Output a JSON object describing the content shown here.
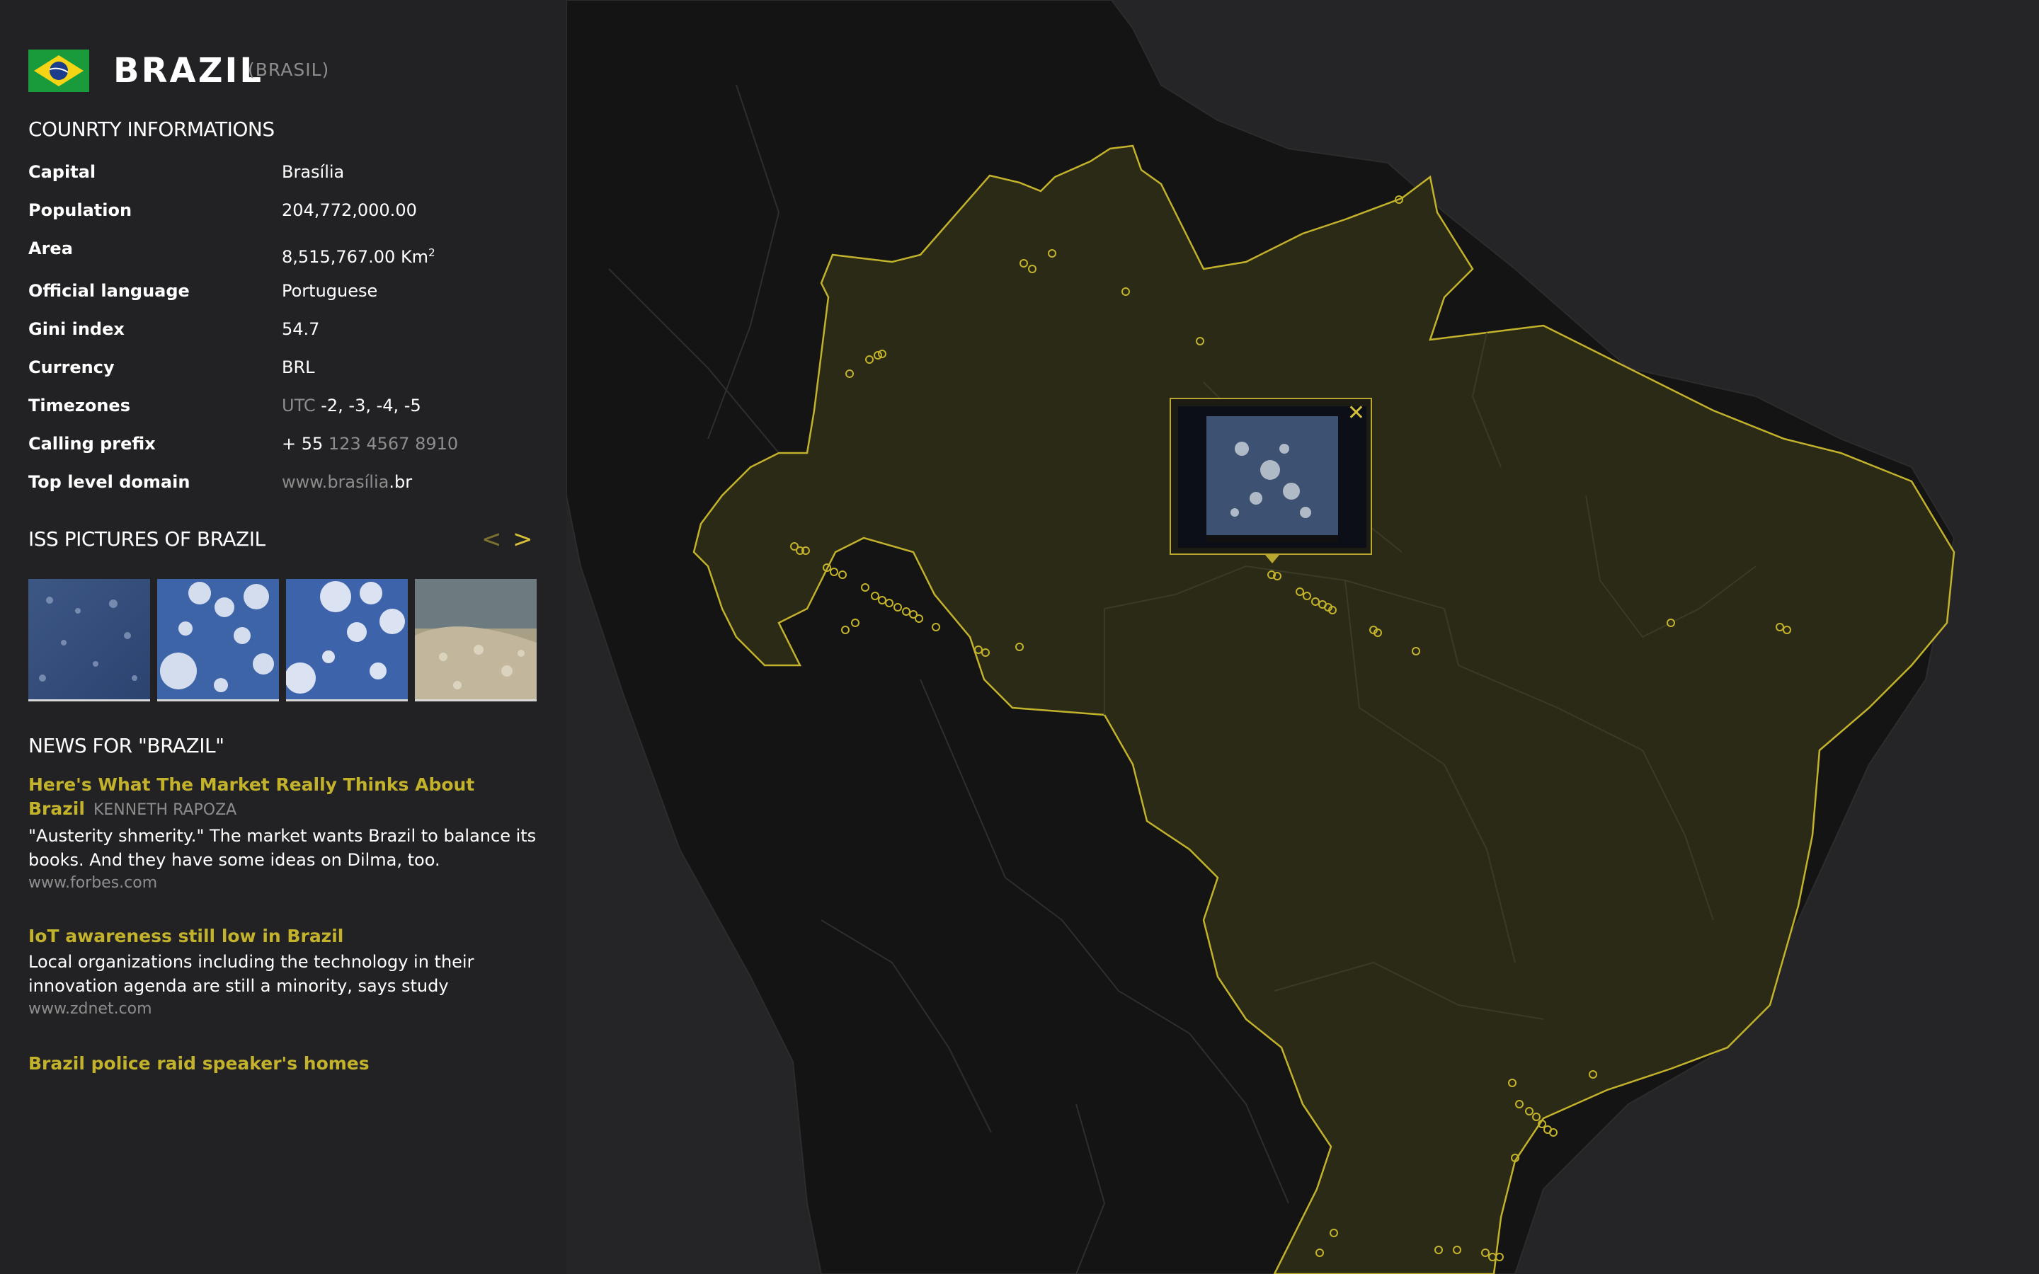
{
  "country": {
    "name": "BRAZIL",
    "native_name": "(BRASIL)",
    "flag_icon": "brazil-flag-icon"
  },
  "info": {
    "title": "COUNRTY INFORMATIONS",
    "capital_label": "Capital",
    "capital": "Brasília",
    "population_label": "Population",
    "population": "204,772,000.00",
    "area_label": "Area",
    "area_value": "8,515,767.00 Km",
    "area_exp": "2",
    "language_label": "Official language",
    "language": "Portuguese",
    "gini_label": "Gini index",
    "gini": "54.7",
    "currency_label": "Currency",
    "currency": "BRL",
    "timezones_label": "Timezones",
    "timezones_prefix": "UTC",
    "timezones": "-2, -3, -4, -5",
    "calling_label": "Calling prefix",
    "calling_prefix": "+ 55",
    "calling_example": "123 4567 8910",
    "tld_label": "Top level domain",
    "tld_example": "www.brasília",
    "tld": ".br"
  },
  "iss": {
    "title": "ISS PICTURES OF BRAZIL",
    "prev_icon": "<",
    "next_icon": ">"
  },
  "news": {
    "title": "NEWS FOR \"BRAZIL\"",
    "items": [
      {
        "title_line1": "Here's What The Market Really Thinks About",
        "title_line2": "Brazil",
        "author": "KENNETH RAPOZA",
        "desc": "\"Austerity shmerity.\" The market wants Brazil to balance its books. And they have some ideas on Dilma, too.",
        "source": "www.forbes.com"
      },
      {
        "title": "IoT awareness still low in Brazil",
        "desc": "Local organizations including the technology in their innovation agenda are still a minority, says study",
        "source": "www.zdnet.com"
      },
      {
        "title": "Brazil police raid speaker's homes"
      }
    ]
  },
  "popup": {
    "close_icon": "✕"
  },
  "colors": {
    "accent": "#c3b22c",
    "sidebar_bg": "#222224",
    "map_bg": "#131313",
    "highlight_fill": "#2b2a17"
  }
}
